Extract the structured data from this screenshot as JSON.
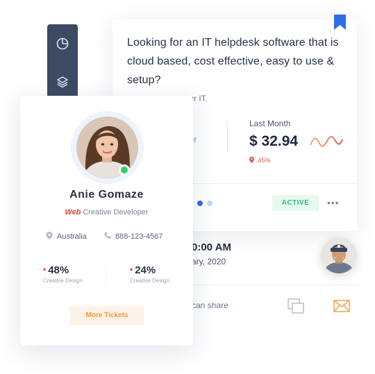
{
  "sidebar": {
    "icons": [
      "pie-chart-icon",
      "layers-icon"
    ]
  },
  "main": {
    "question": "Looking for an IT helpdesk software that is cloud based, cost effective, easy to use & setup?",
    "subtext_visible": "your IT.",
    "stat_left_fragment": "per",
    "last_month_label": "Last Month",
    "last_month_value": "$ 32.94",
    "change": ".45%",
    "status_badge": "ACTIVE",
    "more_menu": "•••"
  },
  "schedule": {
    "time": "0:00 AM",
    "date": "ary, 2020"
  },
  "share": {
    "text": "can share"
  },
  "profile": {
    "name": "Anie Gomaze",
    "role_highlight": "Web",
    "role": "Creative Developer",
    "location": "Australia",
    "phone": "888-123-4567",
    "stats": [
      {
        "value": "48%",
        "label": "Creative Design"
      },
      {
        "value": "24%",
        "label": "Creative Design"
      }
    ],
    "button": "More Tickets"
  },
  "colors": {
    "accent_blue": "#2f6ce8",
    "sidebar": "#3d4a63",
    "active_green": "#2fbd7b",
    "alert_red": "#e5452d",
    "button_orange": "#f19a3e"
  }
}
